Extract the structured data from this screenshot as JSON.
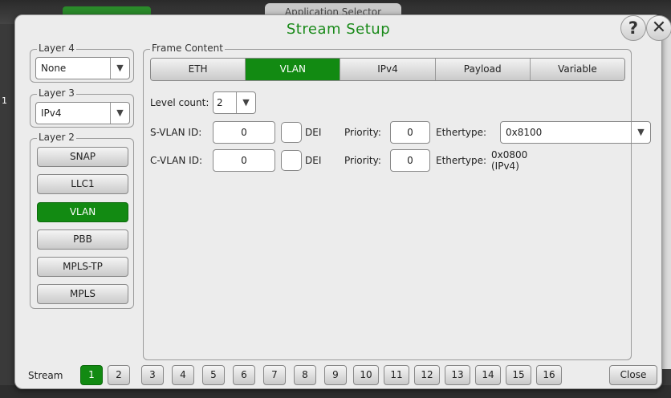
{
  "background": {
    "app_selector_label": "Application Selector",
    "left_edge_number": "1"
  },
  "dialog": {
    "title": "Stream Setup",
    "help_glyph": "?",
    "close_glyph": "✕"
  },
  "layer4": {
    "legend": "Layer 4",
    "value": "None"
  },
  "layer3": {
    "legend": "Layer 3",
    "value": "IPv4"
  },
  "layer2": {
    "legend": "Layer 2",
    "buttons": [
      "SNAP",
      "LLC1",
      "VLAN",
      "PBB",
      "MPLS-TP",
      "MPLS"
    ],
    "selected": "VLAN"
  },
  "frame_content": {
    "legend": "Frame Content",
    "tabs": [
      "ETH",
      "VLAN",
      "IPv4",
      "Payload",
      "Variable"
    ],
    "selected_tab": "VLAN",
    "level_count_label": "Level count:",
    "level_count_value": "2",
    "svlan": {
      "label": "S-VLAN ID:",
      "id": "0",
      "dei_label": "DEI",
      "priority_label": "Priority:",
      "priority": "0",
      "ethertype_label": "Ethertype:",
      "ethertype": "0x8100"
    },
    "cvlan": {
      "label": "C-VLAN ID:",
      "id": "0",
      "dei_label": "DEI",
      "priority_label": "Priority:",
      "priority": "0",
      "ethertype_label": "Ethertype:",
      "ethertype_line1": "0x0800",
      "ethertype_line2": "(IPv4)"
    }
  },
  "stream_bar": {
    "label": "Stream",
    "streams": [
      "1",
      "2",
      "3",
      "4",
      "5",
      "6",
      "7",
      "8",
      "9",
      "10",
      "11",
      "12",
      "13",
      "14",
      "15",
      "16"
    ],
    "selected": "1",
    "close_label": "Close"
  },
  "colors": {
    "accent_green": "#128a12",
    "title_green": "#1a8a1a",
    "dialog_bg": "#ececec"
  },
  "icons": {
    "dropdown": "chevron-down-icon",
    "help": "help-icon",
    "close": "close-icon"
  }
}
